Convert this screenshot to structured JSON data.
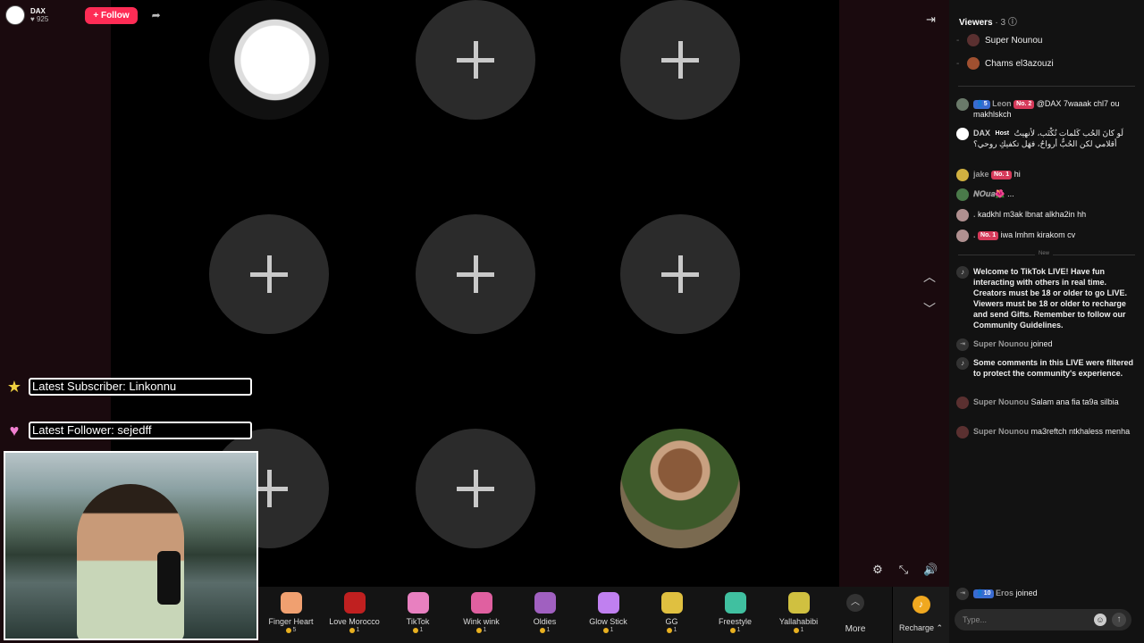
{
  "host": {
    "name": "DAX",
    "likes": "925",
    "follow_label": "+ Follow"
  },
  "overlay": {
    "subscriber": "Latest Subscriber: Linkonnu",
    "follower": "Latest Follower: sejedff"
  },
  "gifts": [
    {
      "name": "Finger Heart",
      "price": "5",
      "color": "#f0a070",
      "icon": "finger-heart-icon"
    },
    {
      "name": "Love Morocco",
      "price": "1",
      "color": "#c02020",
      "icon": "love-morocco-icon"
    },
    {
      "name": "TikTok",
      "price": "1",
      "color": "#e880c0",
      "icon": "tiktok-icon"
    },
    {
      "name": "Wink wink",
      "price": "1",
      "color": "#e060a0",
      "icon": "wink-icon"
    },
    {
      "name": "Oldies",
      "price": "1",
      "color": "#a060c0",
      "icon": "oldies-icon"
    },
    {
      "name": "Glow Stick",
      "price": "1",
      "color": "#c080f0",
      "icon": "glow-stick-icon"
    },
    {
      "name": "GG",
      "price": "1",
      "color": "#e0c040",
      "icon": "gg-icon"
    },
    {
      "name": "Freestyle",
      "price": "1",
      "color": "#40c0a0",
      "icon": "freestyle-icon"
    },
    {
      "name": "Yallahabibi",
      "price": "1",
      "color": "#d0c040",
      "icon": "yallahabibi-icon"
    }
  ],
  "more_label": "More",
  "recharge_label": "Recharge",
  "viewers": {
    "title": "Viewers",
    "count": "· 3",
    "list": [
      "Super Nounou",
      "Chams el3azouzi"
    ]
  },
  "chat": [
    {
      "name": "Leon",
      "level": "5",
      "rank": "No. 2",
      "text": "@DAX 7waaak chl7 ou makhlskch"
    },
    {
      "name": "DAX",
      "host": "Host",
      "text": "لَو كانَ الحُب كَلمات تُكْتَب، لأنهيتُ أقلامي لكن الحُبُّ أرواحٌ، فهَل تكفيكِ روحي؟"
    },
    {
      "name": "jake",
      "rank": "No. 1",
      "text": "hi"
    },
    {
      "name": "𝑵𝑶𝒖𝒂🌺",
      "text": "..."
    },
    {
      "name": ".",
      "text": "kadkhl m3ak lbnat alkha2in hh"
    },
    {
      "name": ".",
      "rank": "No. 1",
      "text": "iwa lmhm kirakom cv"
    }
  ],
  "new_label": "New",
  "system": [
    {
      "type": "tiktok",
      "text": "Welcome to TikTok LIVE! Have fun interacting with others in real time. Creators must be 18 or older to go LIVE. Viewers must be 18 or older to recharge and send Gifts. Remember to follow our Community Guidelines."
    },
    {
      "type": "join",
      "name": "Super Nounou",
      "text": "joined"
    },
    {
      "type": "tiktok",
      "text": "Some comments in this LIVE were filtered to protect the community's experience."
    },
    {
      "type": "msg",
      "name": "Super Nounou",
      "text": "Salam ana fia ta9a silbia"
    },
    {
      "type": "msg",
      "name": "Super Nounou",
      "text": "ma3reftch ntkhaless menha"
    }
  ],
  "last_join": {
    "name": "Eros",
    "level": "10",
    "text": "joined"
  },
  "input": {
    "placeholder": "Type..."
  }
}
